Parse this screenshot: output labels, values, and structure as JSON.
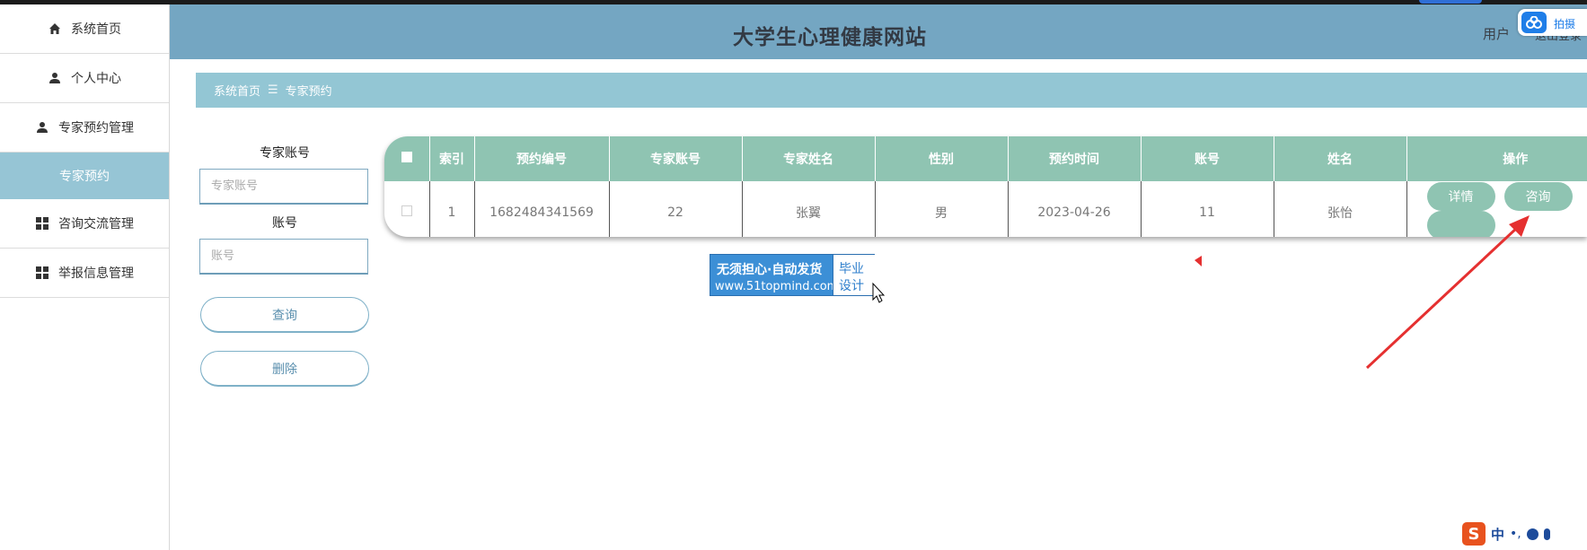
{
  "app": {
    "title": "大学生心理健康网站"
  },
  "header": {
    "user_label": "用户",
    "user_extra": "退出登录",
    "badge_text": "拍摄"
  },
  "sidebar": {
    "items": [
      {
        "label": "系统首页",
        "icon": "home-icon"
      },
      {
        "label": "个人中心",
        "icon": "person-icon"
      },
      {
        "label": "专家预约管理",
        "icon": "person-icon"
      },
      {
        "label": "专家预约",
        "icon": "",
        "active": true
      },
      {
        "label": "咨询交流管理",
        "icon": "grid-icon"
      },
      {
        "label": "举报信息管理",
        "icon": "grid-icon"
      }
    ]
  },
  "breadcrumb": {
    "home": "系统首页",
    "separator": "☰",
    "current": "专家预约"
  },
  "search": {
    "expert_account_label": "专家账号",
    "expert_account_placeholder": "专家账号",
    "account_label": "账号",
    "account_placeholder": "账号",
    "query_button": "查询",
    "delete_button": "删除"
  },
  "table": {
    "headers": [
      "索引",
      "预约编号",
      "专家账号",
      "专家姓名",
      "性别",
      "预约时间",
      "账号",
      "姓名",
      "操作"
    ],
    "rows": [
      {
        "index": "1",
        "booking_no": "1682484341569",
        "expert_account": "22",
        "expert_name": "张翼",
        "gender": "男",
        "time": "2023-04-26",
        "account": "11",
        "name": "张怡"
      }
    ],
    "row_actions": [
      "详情",
      "咨询"
    ]
  },
  "ad": {
    "line1": "无须担心·自动发货",
    "line2": "www.51topmind.com",
    "right1": "毕业",
    "right2": "设计"
  },
  "ime": {
    "label": "中"
  },
  "colors": {
    "header": "#74a6c2",
    "breadcrumb": "#93c6d4",
    "table_head": "#8fc4b2",
    "sidebar_active": "#96c5d5",
    "arrow": "#e53030"
  }
}
